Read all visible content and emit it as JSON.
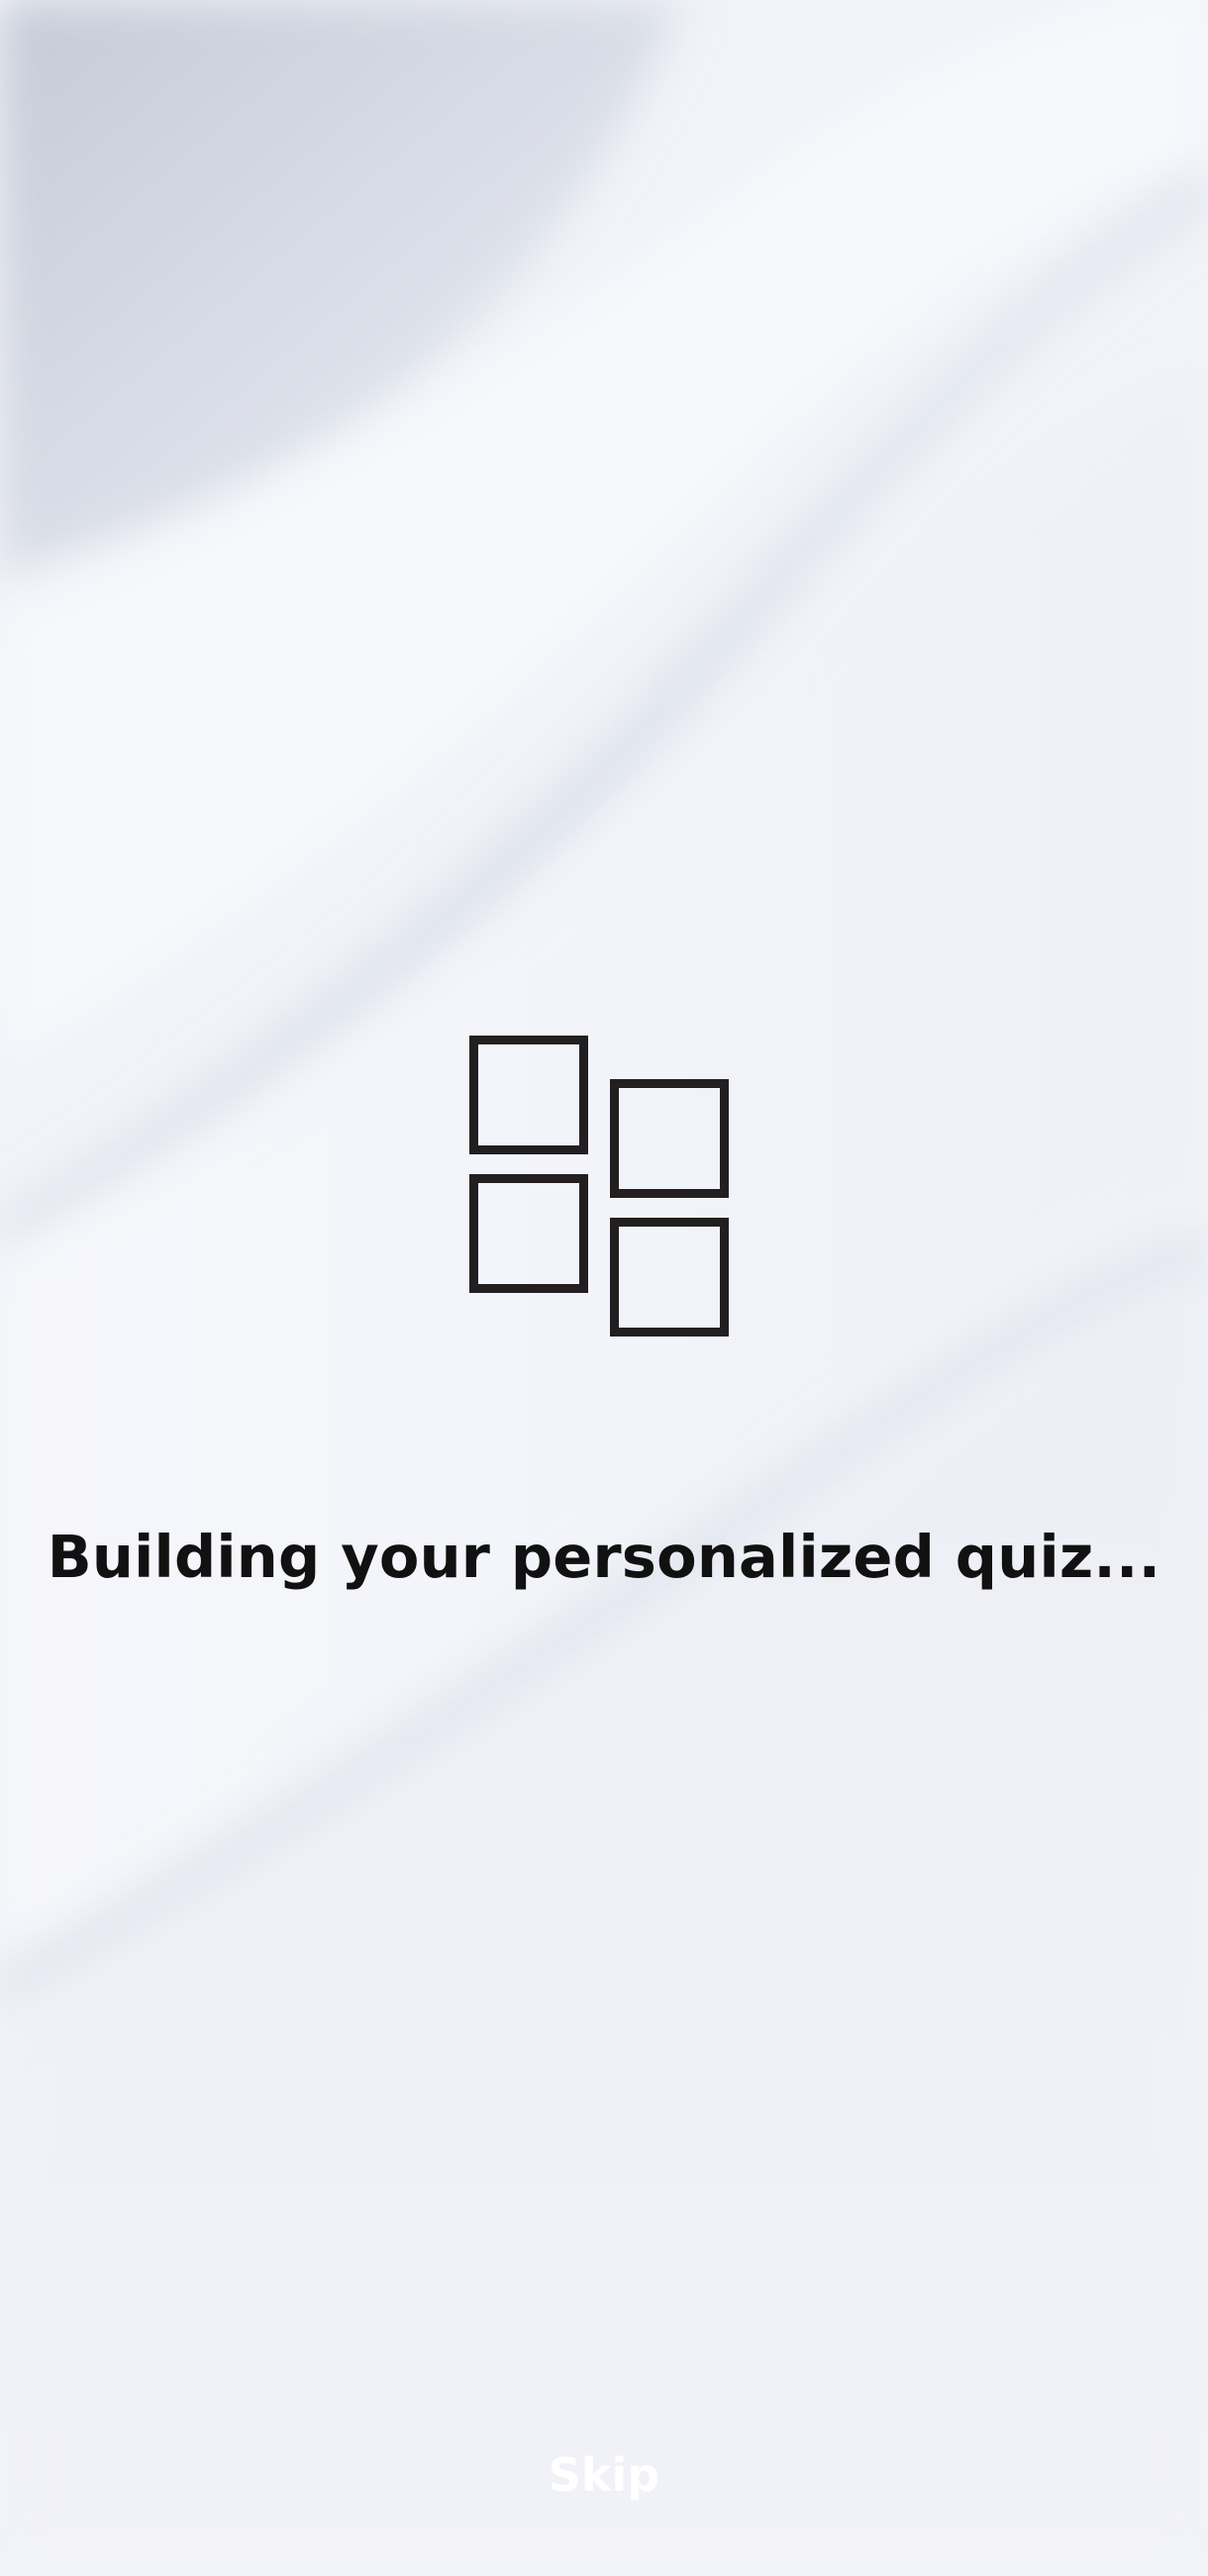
{
  "screen": {
    "title": "Building your personalized quiz...",
    "skip_label": "Skip",
    "icon": "four-squares-icon"
  },
  "colors": {
    "background": "#eef0f6",
    "text": "#111111",
    "icon_stroke": "#231f20",
    "skip_text": "#ffffff"
  }
}
